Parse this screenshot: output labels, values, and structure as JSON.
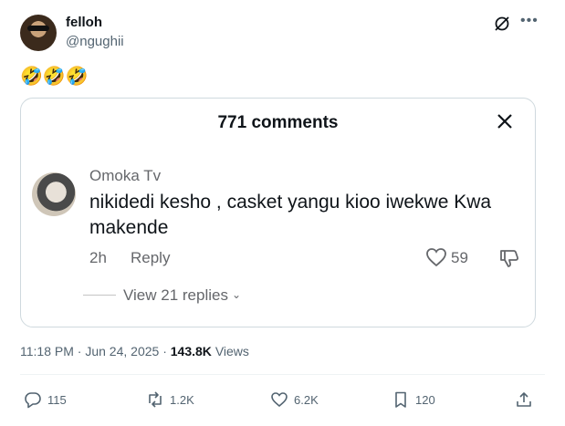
{
  "author": {
    "name": "felloh",
    "handle": "@ngughii"
  },
  "tweet": {
    "text": "🤣🤣🤣"
  },
  "card": {
    "title": "771 comments",
    "comment": {
      "author": "Omoka Tv",
      "text": "nikidedi kesho , casket yangu kioo iwekwe Kwa makende",
      "time": "2h",
      "reply_label": "Reply",
      "likes": "59",
      "view_replies": "View 21 replies"
    }
  },
  "meta": {
    "time": "11:18 PM",
    "separator": "·",
    "date": "Jun 24, 2025",
    "separator2": "·",
    "views": "143.8K",
    "views_label": "Views"
  },
  "actions": {
    "replies": "115",
    "reposts": "1.2K",
    "likes": "6.2K",
    "bookmarks": "120"
  },
  "icons": [
    "grok-icon",
    "more-icon",
    "close-icon",
    "heart-icon",
    "thumbs-down-icon",
    "chevron-down-icon",
    "reply-icon",
    "repost-icon",
    "like-icon",
    "bookmark-icon",
    "share-icon"
  ]
}
